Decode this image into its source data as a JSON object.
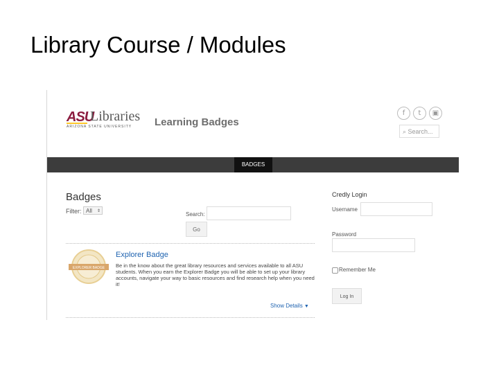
{
  "slide": {
    "title": "Library Course / Modules"
  },
  "header": {
    "logo_asu": "ASU",
    "logo_libraries": "Libraries",
    "logo_subtitle": "ARIZONA STATE UNIVERSITY",
    "site_title": "Learning Badges",
    "social_icons": [
      "facebook-icon",
      "twitter-icon",
      "instagram-icon"
    ],
    "search_placeholder": "⌕ Search..."
  },
  "nav": {
    "tabs": [
      {
        "label": "BADGES",
        "active": true
      }
    ]
  },
  "badges": {
    "heading": "Badges",
    "filter_label": "Filter:",
    "filter_value": "All",
    "search_label": "Search:",
    "search_value": "",
    "go_label": "Go",
    "items": [
      {
        "title": "Explorer Badge",
        "image_text": "EXPLORER BADGE",
        "description": "Be in the know about the great library resources and services available to all ASU students. When you earn the Explorer Badge you will be able to set up your library accounts, navigate your way to basic resources and find research help when you need it!",
        "show_details": "Show Details"
      }
    ]
  },
  "credly": {
    "title": "Credly Login",
    "username_label": "Username",
    "username_value": "",
    "password_label": "Password",
    "password_value": "",
    "remember_label": "Remember Me",
    "remember_checked": false,
    "login_label": "Log In"
  },
  "colors": {
    "asu_maroon": "#8c1d40",
    "asu_gold": "#ffc627",
    "navbar": "#3c3c3c",
    "link": "#1f63b0"
  }
}
